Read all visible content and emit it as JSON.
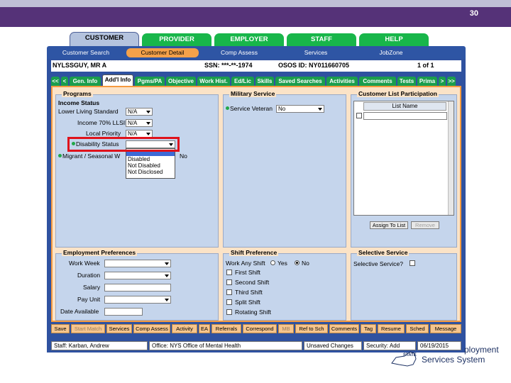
{
  "slide_number": "30",
  "main_tabs": [
    "CUSTOMER",
    "PROVIDER",
    "EMPLOYER",
    "STAFF",
    "HELP"
  ],
  "sub_tabs": [
    "Customer Search",
    "Customer Detail",
    "Comp Assess",
    "Services",
    "JobZone"
  ],
  "header": {
    "name": "NYLSSGUY, MR A",
    "ssn": "SSN: ***-**-1974",
    "osos_id": "OSOS ID: NY011660705",
    "page": "1 of 1"
  },
  "inner_tabs": [
    "<<",
    "<",
    "Gen. Info",
    "Add'l Info",
    "Pgms/PA",
    "Objective",
    "Work Hist.",
    "Ed/Lic",
    "Skills",
    "Saved Searches",
    "Activities",
    "Comments",
    "Tests",
    "Prima",
    ">",
    ">>"
  ],
  "programs": {
    "title": "Programs",
    "income_status": "Income Status",
    "lower_living_label": "Lower Living Standard",
    "lower_living_value": "N/A",
    "income_label": "Income 70% LLSIL",
    "income_value": "N/A",
    "local_priority_label": "Local Priority",
    "local_priority_value": "N/A",
    "disability_label": "Disability Status",
    "disability_value": "",
    "disability_options": [
      "Disabled",
      "Not Disabled",
      "Not Disclosed"
    ],
    "migrant_label": "Migrant / Seasonal W",
    "migrant_value": "No"
  },
  "military": {
    "title": "Military Service",
    "veteran_label": "Service Veteran",
    "veteran_value": "No"
  },
  "customer_list": {
    "title": "Customer List Participation",
    "column": "List Name",
    "assign_button": "Assign To List",
    "remove_button": "Remove"
  },
  "employment": {
    "title": "Employment Preferences",
    "work_week": "Work Week",
    "duration": "Duration",
    "salary": "Salary",
    "pay_unit": "Pay Unit",
    "date_available": "Date Available"
  },
  "shift": {
    "title": "Shift Preference",
    "work_any_shift": "Work Any Shift",
    "yes": "Yes",
    "no": "No",
    "options": [
      "First Shift",
      "Second Shift",
      "Third Shift",
      "Split Shift",
      "Rotating Shift"
    ]
  },
  "selective": {
    "title": "Selective Service",
    "label": "Selective Service?"
  },
  "bottom_buttons": [
    "Save",
    "Start Match",
    "Services",
    "Comp Assess",
    "Activity",
    "EA",
    "Referrals",
    "Correspond",
    "MB",
    "Ref to Sch",
    "Comments",
    "Tag",
    "Resume",
    "Sched",
    "Message"
  ],
  "status": {
    "staff": "Staff: Karban, Andrew",
    "office": "Office: NYS Office of Mental Health",
    "unsaved": "Unsaved Changes",
    "security": "Security: Add",
    "date": "06/19/2015"
  },
  "logo": {
    "line1": "ployment",
    "line2": "Services System",
    "state": "STATE"
  },
  "colors": {
    "header_band": "#553278",
    "tab_green": "#18b64a",
    "nav_blue": "#2e55a4",
    "active_orange": "#f5a14a",
    "content_bg": "#fbe3c7",
    "panel_bg": "#c5d5ec",
    "highlight_red": "#e0121b"
  }
}
